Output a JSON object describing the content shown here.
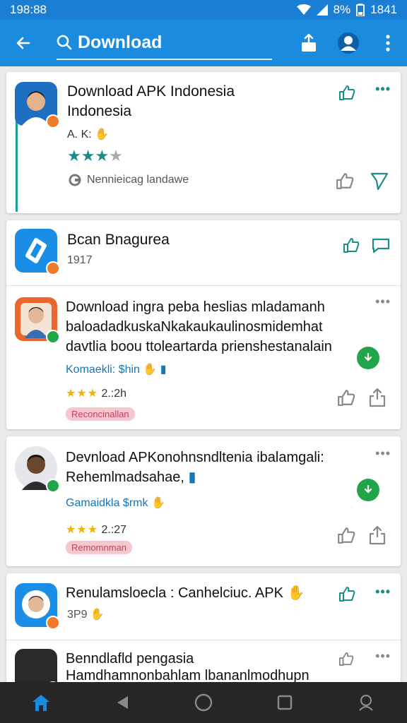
{
  "status": {
    "time": "198:88",
    "battery_pct": "8%",
    "clock": "1841"
  },
  "search": {
    "value": "Download"
  },
  "items": [
    {
      "title_line1": "Download APK Indonesia",
      "title_line2": "Indonesia",
      "meta": "A. K:",
      "rating": "★★★",
      "rating_empty": "★",
      "sub": "Nennieicag landawe"
    },
    {
      "title": "Bcan Bnagurea",
      "meta": "1917"
    },
    {
      "title_line1": "Download ingra peba heslias mladamanh",
      "title_line2": "baloadadkuskaNkakaukaulinosmidemhat",
      "title_line3": "davtlia boou ttoleartarda prienshestanalain",
      "meta": "Komaekli: $hin",
      "rating": "★★★",
      "rating_text": "2.:2h",
      "tag": "Reconcinallan"
    },
    {
      "title_line1": "Devnload APKonohnsndltenia ibalamgali:",
      "title_line2": "Rehemlmadsahae,",
      "meta": "Gamaidkla $rmk",
      "rating": "★★★",
      "rating_text": "2.:27",
      "tag": "Remomnman"
    },
    {
      "title": "Renulamsloecla : Canhelciuc. APK",
      "meta": "3P9"
    },
    {
      "title_line1": "Benndlafld pengasia",
      "title_line2": "Hamdhamnonbahlam lbananlmodhupn"
    }
  ],
  "colors": {
    "app_bar": "#1b8be0",
    "status_bar": "#1a7fd4",
    "accent": "#1a8d8a",
    "star": "#f0b400",
    "fab": "#22a54a",
    "nav_bar": "#262626",
    "nav_active": "#1b8be0"
  },
  "icons": [
    "back-arrow-icon",
    "search-icon",
    "share-icon",
    "profile-icon",
    "more-vert-icon",
    "like-icon",
    "more-horizontal-icon",
    "send-icon",
    "chat-icon",
    "download-icon",
    "home-icon",
    "back-triangle-icon",
    "circle-home-icon",
    "square-recents-icon",
    "assistant-icon"
  ]
}
